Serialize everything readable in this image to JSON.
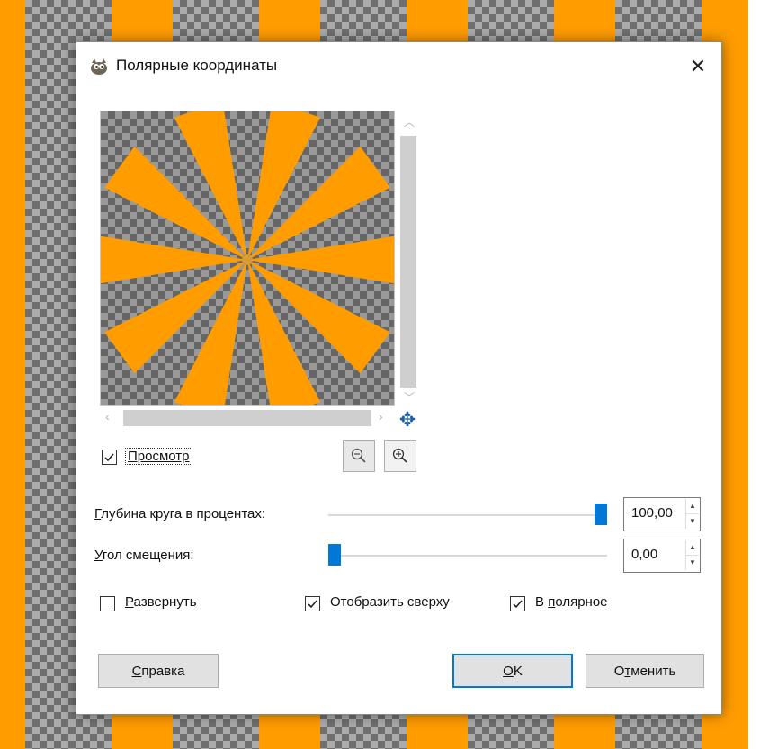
{
  "colors": {
    "orange": "#ff9c00",
    "accent": "#0078d7",
    "checker_dark": "#6f6f6f",
    "checker_light": "#ababab"
  },
  "dialog": {
    "title": "Полярные координаты",
    "icon": "gimp-wilber-icon",
    "close_glyph": "✕"
  },
  "preview": {
    "checkbox_label": "Просмотр",
    "checked": true,
    "navigate_icon": "move-navigate-icon",
    "zoom_out_icon": "zoom-out-icon",
    "zoom_in_icon": "zoom-in-icon"
  },
  "params": {
    "depth_label": "Глубина круга в процентах:",
    "depth_value": "100,00",
    "depth_fraction": 1.0,
    "angle_label": "Угол смещения:",
    "angle_value": "0,00",
    "angle_fraction": 0.0
  },
  "options": {
    "flip_label": "Развернуть",
    "flip_checked": false,
    "top_label": "Отобразить сверху",
    "top_checked": true,
    "polar_label": "В полярное",
    "polar_checked": true
  },
  "buttons": {
    "help": "Справка",
    "ok": "OK",
    "cancel": "Отменить"
  }
}
